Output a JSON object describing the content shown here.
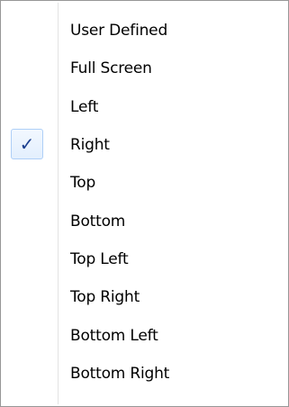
{
  "menu": {
    "items": [
      {
        "label": "User Defined",
        "checked": false
      },
      {
        "label": "Full Screen",
        "checked": false
      },
      {
        "label": "Left",
        "checked": false
      },
      {
        "label": "Right",
        "checked": true
      },
      {
        "label": "Top",
        "checked": false
      },
      {
        "label": "Bottom",
        "checked": false
      },
      {
        "label": "Top Left",
        "checked": false
      },
      {
        "label": "Top Right",
        "checked": false
      },
      {
        "label": "Bottom Left",
        "checked": false
      },
      {
        "label": "Bottom Right",
        "checked": false
      }
    ],
    "check_glyph": "✓",
    "colors": {
      "check": "#1b3f8f",
      "check_bg": "#e3effd",
      "border": "#979797"
    }
  }
}
